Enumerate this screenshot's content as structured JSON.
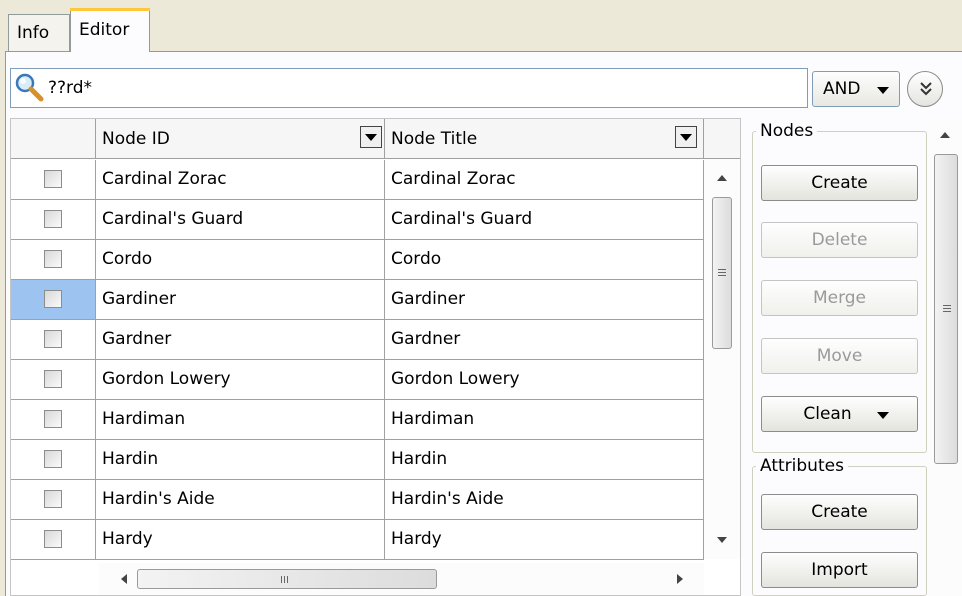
{
  "tabs": {
    "info": "Info",
    "editor": "Editor"
  },
  "search": {
    "value": "??rd*",
    "operator": "AND"
  },
  "grid": {
    "columns": {
      "id": "Node ID",
      "title": "Node Title"
    },
    "rows": [
      {
        "id": "Cardinal Zorac",
        "title": "Cardinal Zorac",
        "selected": false
      },
      {
        "id": "Cardinal's Guard",
        "title": "Cardinal's Guard",
        "selected": false
      },
      {
        "id": "Cordo",
        "title": "Cordo",
        "selected": false
      },
      {
        "id": "Gardiner",
        "title": "Gardiner",
        "selected": true
      },
      {
        "id": "Gardner",
        "title": "Gardner",
        "selected": false
      },
      {
        "id": "Gordon Lowery",
        "title": "Gordon Lowery",
        "selected": false
      },
      {
        "id": "Hardiman",
        "title": "Hardiman",
        "selected": false
      },
      {
        "id": "Hardin",
        "title": "Hardin",
        "selected": false
      },
      {
        "id": "Hardin's Aide",
        "title": "Hardin's Aide",
        "selected": false
      },
      {
        "id": "Hardy",
        "title": "Hardy",
        "selected": false
      }
    ]
  },
  "nodes": {
    "title": "Nodes",
    "create": "Create",
    "delete": "Delete",
    "merge": "Merge",
    "move": "Move",
    "clean": "Clean"
  },
  "attributes": {
    "title": "Attributes",
    "create": "Create",
    "import": "Import"
  },
  "colors": {
    "selection": "#9dc3f0",
    "tab_accent": "#ffc83c"
  },
  "icons": {
    "search": "search-icon",
    "expand": "double-chevron-down-icon"
  }
}
